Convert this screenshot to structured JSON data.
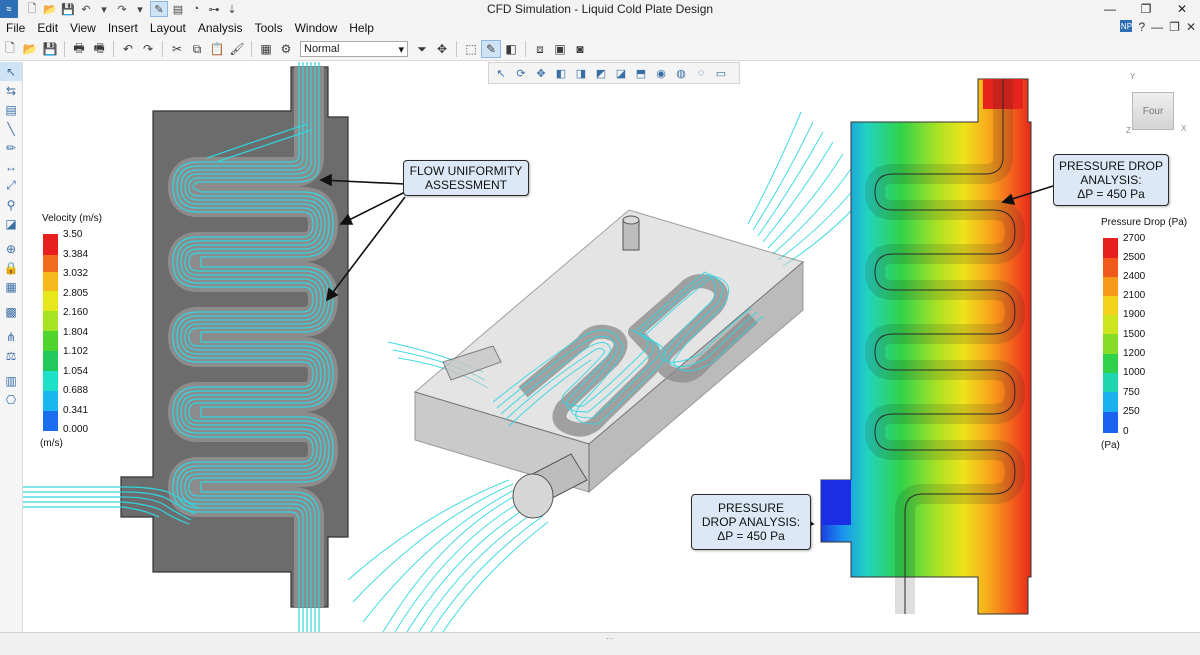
{
  "window": {
    "title": "CFD Simulation - Liquid Cold Plate Design",
    "controls": [
      "—",
      "❐",
      "✕"
    ]
  },
  "menu": {
    "items": [
      "File",
      "Edit",
      "View",
      "Insert",
      "Layout",
      "Analysis",
      "Tools",
      "Window",
      "Help"
    ],
    "right_badge": "NP"
  },
  "toolbar": {
    "style_value": "Normal"
  },
  "velocity_legend": {
    "title": "Velocity (m/s)",
    "unit": "(m/s)",
    "labels": [
      "3.50",
      "3.384",
      "3.032",
      "2.805",
      "2.160",
      "1.804",
      "1.102",
      "1.054",
      "0.688",
      "0.341",
      "0.000"
    ],
    "colors": [
      "#e81f1f",
      "#f26a1d",
      "#f7b81c",
      "#e7e81c",
      "#a6e323",
      "#4fd32d",
      "#20c95a",
      "#1ee0c8",
      "#18b7ee",
      "#1c6df0",
      "#1b2ee8"
    ]
  },
  "pressure_legend": {
    "title": "Pressure Drop (Pa)",
    "unit": "(Pa)",
    "labels": [
      "2700",
      "2500",
      "2400",
      "2100",
      "1900",
      "1500",
      "1200",
      "1000",
      "750",
      "250",
      "0"
    ],
    "colors": [
      "#e81f1f",
      "#f25a1c",
      "#f79a1b",
      "#f2d21a",
      "#cde51e",
      "#86dc27",
      "#2ed24a",
      "#20d6b0",
      "#1bb0ee",
      "#1b63ee",
      "#1b27e3"
    ]
  },
  "callouts": {
    "flow": [
      "FLOW UNIFORMITY",
      "ASSESSMENT"
    ],
    "pressure_top": [
      "PRESSURE DROP",
      "ANALYSIS:",
      "ΔP = 450 Pa"
    ],
    "pressure_bottom": [
      "PRESSURE",
      "DROP ANALYSIS:",
      "ΔP = 450 Pa"
    ]
  },
  "navcube": {
    "face": "Four",
    "axis_y": "Y",
    "axis_x": "X",
    "axis_z": "Z"
  },
  "colors": {
    "streamline": "#2fd6e0",
    "plate": "#6e6e6e",
    "channel": "#8a8a8a",
    "callout_bg": "#dce8f5"
  }
}
